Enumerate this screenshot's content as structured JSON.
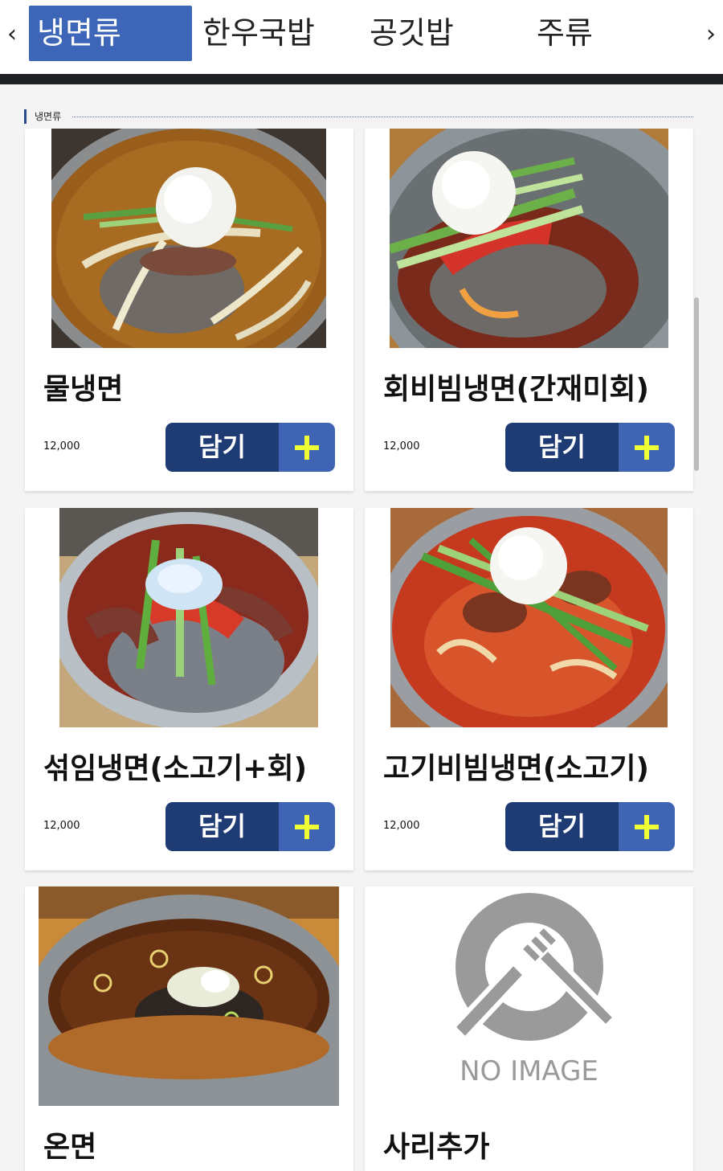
{
  "tabs": {
    "prev_arrow": "‹",
    "next_arrow": "›",
    "items": [
      {
        "label": "냉면류"
      },
      {
        "label": "한우국밥"
      },
      {
        "label": "공깃밥"
      },
      {
        "label": "주류"
      }
    ]
  },
  "section": {
    "title": "냉면류"
  },
  "menu": {
    "add_label": "담기",
    "items": [
      {
        "name": "물냉면",
        "price": "12,000"
      },
      {
        "name": "회비빔냉면(간재미회)",
        "price": "12,000"
      },
      {
        "name": "섞임냉면(소고기+회)",
        "price": "12,000"
      },
      {
        "name": "고기비빔냉면(소고기)",
        "price": "12,000"
      },
      {
        "name": "온면"
      },
      {
        "name": "사리추가",
        "image_placeholder": "NO IMAGE"
      }
    ]
  },
  "colors": {
    "tab_active": "#3d66b8",
    "button_dark": "#1f3b74",
    "button_plus": "#3f64b3",
    "plus_icon": "#f0ff33"
  }
}
